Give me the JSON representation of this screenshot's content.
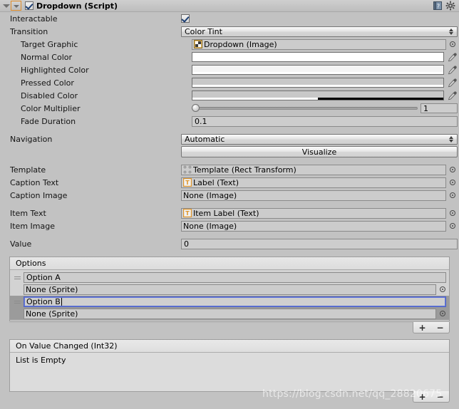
{
  "header": {
    "title": "Dropdown (Script)",
    "enabled_checkbox": true,
    "foldout_icon": "foldout-triangle-icon",
    "script_icon": "script-dropdown-icon",
    "help_icon": "help-book-icon",
    "settings_icon": "gear-icon"
  },
  "fields": {
    "interactable": {
      "label": "Interactable",
      "checked": true
    },
    "transition": {
      "label": "Transition",
      "value": "Color Tint"
    },
    "target_graphic": {
      "label": "Target Graphic",
      "value": "Dropdown (Image)",
      "icon": "image-sprite-icon"
    },
    "normal_color": {
      "label": "Normal Color",
      "color": "#ffffff",
      "alpha": 100
    },
    "highlighted_color": {
      "label": "Highlighted Color",
      "color": "#f5f5f5",
      "alpha": 100
    },
    "pressed_color": {
      "label": "Pressed Color",
      "color": "#c8c8c8",
      "alpha": 100
    },
    "disabled_color": {
      "label": "Disabled Color",
      "color": "#c8c8c8",
      "alpha": 50
    },
    "color_multiplier": {
      "label": "Color Multiplier",
      "value": "1",
      "slider_pct": 0
    },
    "fade_duration": {
      "label": "Fade Duration",
      "value": "0.1"
    },
    "navigation": {
      "label": "Navigation",
      "value": "Automatic"
    },
    "visualize": {
      "label": "Visualize"
    },
    "template": {
      "label": "Template",
      "value": "Template (Rect Transform)",
      "icon": "rect-transform-icon"
    },
    "caption_text": {
      "label": "Caption Text",
      "value": "Label (Text)",
      "icon": "text-component-icon"
    },
    "caption_image": {
      "label": "Caption Image",
      "value": "None (Image)",
      "icon": "none"
    },
    "item_text": {
      "label": "Item Text",
      "value": "Item Label (Text)",
      "icon": "text-component-icon"
    },
    "item_image": {
      "label": "Item Image",
      "value": "None (Image)",
      "icon": "none"
    },
    "value": {
      "label": "Value",
      "value": "0"
    }
  },
  "options_list": {
    "header": "Options",
    "items": [
      {
        "text": "Option A",
        "sprite": "None (Sprite)",
        "selected": false,
        "focused": false
      },
      {
        "text": "Option B",
        "sprite": "None (Sprite)",
        "selected": true,
        "focused": true
      }
    ],
    "add_label": "+",
    "remove_label": "−"
  },
  "event_section": {
    "header": "On Value Changed (Int32)",
    "empty_label": "List is Empty",
    "add_label": "+",
    "remove_label": "−"
  },
  "watermark": "https://blog.csdn.net/qq_28820675"
}
